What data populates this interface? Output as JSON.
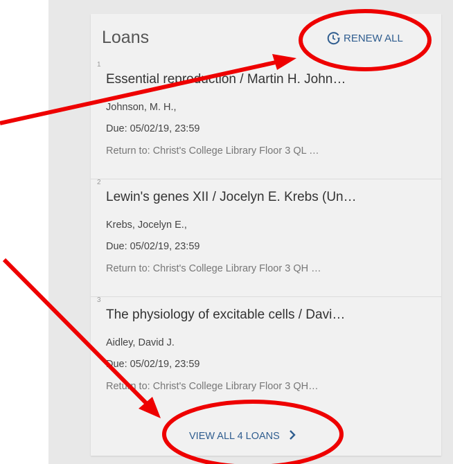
{
  "loans_card": {
    "title": "Loans",
    "renew_all_label": "RENEW ALL",
    "view_all_label": "VIEW ALL 4 LOANS",
    "items": [
      {
        "number": "1",
        "title": "Essential reproduction / Martin H. John…",
        "author": "Johnson, M. H.,",
        "due": "Due: 05/02/19, 23:59",
        "return_to": "Return to: Christ's College Library Floor 3 QL …"
      },
      {
        "number": "2",
        "title": "Lewin's genes XII / Jocelyn E. Krebs (Un…",
        "author": "Krebs, Jocelyn E.,",
        "due": "Due: 05/02/19, 23:59",
        "return_to": "Return to: Christ's College Library Floor 3 QH …"
      },
      {
        "number": "3",
        "title": "The physiology of excitable cells / Davi…",
        "author": "Aidley, David J.",
        "due": "Due: 05/02/19, 23:59",
        "return_to": "Return to: Christ's College Library Floor 3 QH…"
      }
    ]
  },
  "icons": {
    "renew": "renew-clock-icon",
    "chevron": "chevron-right-icon"
  },
  "colors": {
    "accent": "#2f5d8f",
    "annotation": "#ee0000",
    "card_background": "#f1f1f1",
    "page_background": "#e8e8e8"
  }
}
